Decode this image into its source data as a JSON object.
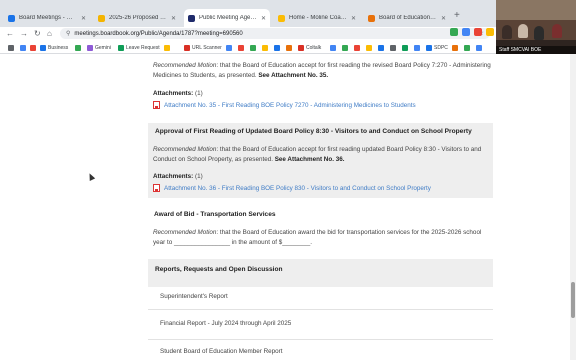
{
  "browser": {
    "tabs": [
      {
        "label": "Board Meetings - Google Drive",
        "color": "#1a73e8"
      },
      {
        "label": "2025-26 Proposed Budget ide",
        "color": "#f4b400"
      },
      {
        "label": "Public Meeting Agenda: June 1",
        "color": "#1f2b6b"
      },
      {
        "label": "Home - Moline Coal Valley Sch",
        "color": "#fbbc04"
      },
      {
        "label": "Board of Education Home - Bo",
        "color": "#e8710a"
      }
    ],
    "url": "meetings.boardbook.org/Public/Agenda/1787?meeting=690560",
    "bookmarks": [
      "Business",
      "Gemini",
      "Leave Request",
      "URL Scanner",
      "Coltalk",
      "SDPC",
      "Staff SMCVAI BOE"
    ],
    "webcam_caption": "Staff SMCVAI BOE"
  },
  "agenda": {
    "item_top": {
      "motion_label": "Recommended Motion",
      "motion_text": ": that the Board of Education accept for first reading the revised Board Policy 7:270 - Administering Medicines to Students, as presented. ",
      "motion_ref": "See Attachment No. 35.",
      "attachments_label": "Attachments:",
      "attachments_count": " (1)",
      "attachment_link": "Attachment No. 35 - First Reading BOE Policy 7270 - Administering Medicines to Students"
    },
    "item_830": {
      "title": "Approval of First Reading of Updated Board Policy 8:30 - Visitors to and Conduct on School Property",
      "motion_label": "Recommended Motion",
      "motion_text": ": that the Board of Education accept for first reading updated Board Policy 8:30 - Visitors to and Conduct on School Property, as presented. ",
      "motion_ref": "See Attachment No. 36.",
      "attachments_label": "Attachments:",
      "attachments_count": " (1)",
      "attachment_link": "Attachment No. 36 - First Reading BOE Policy 830 - Visitors to and Conduct on School Property"
    },
    "item_bid": {
      "title": "Award of Bid - Transportation Services",
      "motion_label": "Recommended Motion",
      "motion_text": ": that the Board of Education award the bid for transportation services for the 2025-2026 school year to ________________ in the amount of $________."
    },
    "reports": {
      "title": "Reports, Requests and Open Discussion",
      "items": [
        "Superintendent's Report",
        "Financial Report - July 2024 through April 2025",
        "Student Board of Education Member Report"
      ]
    }
  }
}
